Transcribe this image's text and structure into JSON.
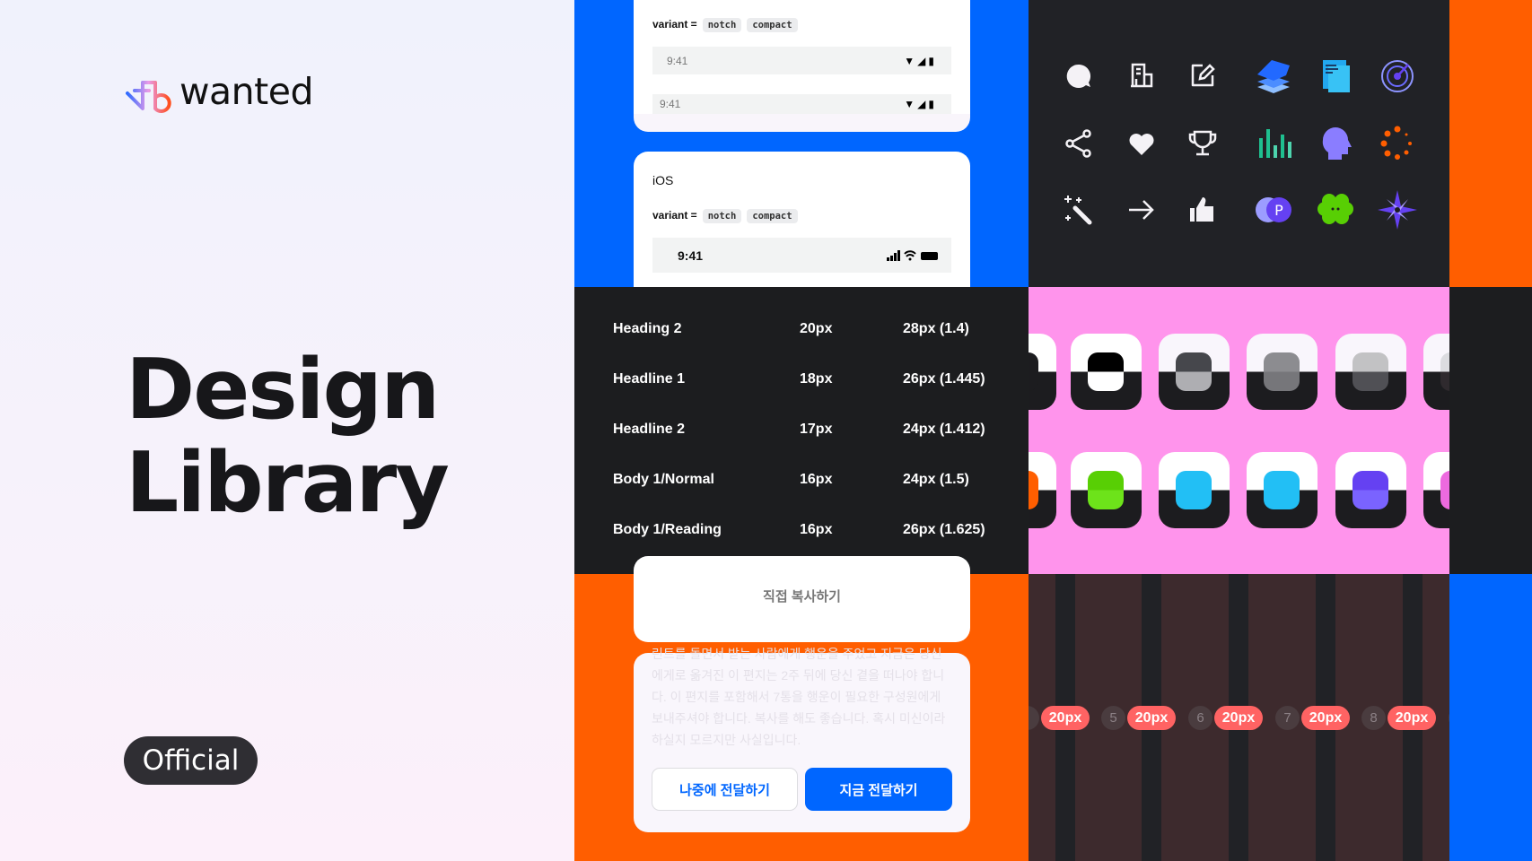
{
  "brand": {
    "name": "wanted"
  },
  "hero": {
    "title_line1": "Design",
    "title_line2": "Library",
    "badge": "Official"
  },
  "status_bar_panel": {
    "android": {
      "variant_label": "variant =",
      "variants": [
        "notch",
        "compact"
      ],
      "time": "9:41"
    },
    "ios": {
      "heading": "iOS",
      "variant_label": "variant =",
      "variants": [
        "notch",
        "compact"
      ],
      "time": "9:41"
    }
  },
  "typography_table": {
    "rows": [
      {
        "name": "Heading 2",
        "size": "20px",
        "line_height": "28px (1.4)"
      },
      {
        "name": "Headline 1",
        "size": "18px",
        "line_height": "26px (1.445)"
      },
      {
        "name": "Headline 2",
        "size": "17px",
        "line_height": "24px (1.412)"
      },
      {
        "name": "Body 1/Normal",
        "size": "16px",
        "line_height": "24px (1.5)"
      },
      {
        "name": "Body 1/Reading",
        "size": "16px",
        "line_height": "26px (1.625)"
      }
    ]
  },
  "dialog": {
    "copy_label": "직접 복사하기",
    "message": "린트를 돌면서 받는 사람에게 행운을 주었고 지금은 당신에게로 옮겨진 이 편지는 2주 뒤에 당신 곁을 떠나야 합니다. 이 편지를 포함해서 7통을 행운이 필요한 구성원에게 보내주셔야 합니다. 복사를 해도 좋습니다. 혹시 미신이라 하실지 모르지만 사실입니다.",
    "later_button": "나중에 전달하기",
    "now_button": "지금 전달하기"
  },
  "icons": [
    "chat-bubble",
    "building",
    "edit",
    "layers",
    "document",
    "target",
    "share",
    "heart",
    "trophy",
    "bar-chart",
    "head-profile",
    "loading-dots",
    "magic-wand",
    "arrow-right",
    "thumbs-up",
    "point-coin",
    "clover",
    "compass-star"
  ],
  "grid": {
    "gutter_label": "20px",
    "columns": [
      "5",
      "6",
      "7",
      "8"
    ]
  },
  "colors": {
    "primary_blue": "#0066FF",
    "orange": "#FF5E00",
    "pink": "#FF94EC",
    "dark": "#1C1D1F",
    "badge_red": "#FF6363"
  },
  "swatches_row1": [
    "#000000",
    "#46474c",
    "#7c7c80",
    "#c2c2c4"
  ],
  "swatches_row2": [
    "#58cf04",
    "#22bff5",
    "#22bff5",
    "#6541f2"
  ]
}
